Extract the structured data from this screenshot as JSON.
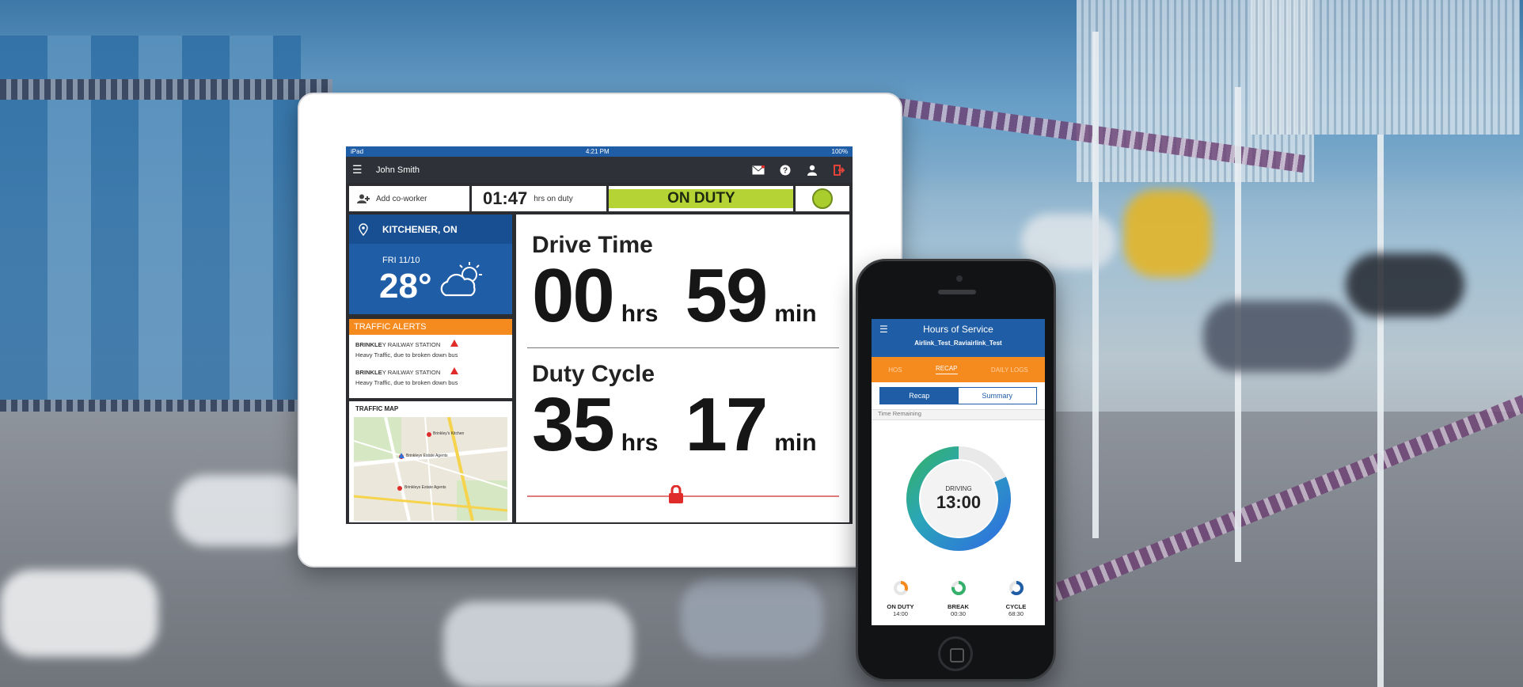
{
  "tablet": {
    "status": {
      "left": "iPad",
      "time": "4:21 PM",
      "battery": "100%"
    },
    "app_bar": {
      "user_name": "John Smith"
    },
    "duty_bar": {
      "add_coworker": "Add co-worker",
      "hours_value": "01:47",
      "hours_label": "hrs on duty",
      "status": "ON DUTY",
      "status_color": "#b5d334"
    },
    "weather": {
      "location": "KITCHENER, ON",
      "date": "FRI 11/10",
      "temperature": "28°",
      "icon": "partly-cloudy-icon"
    },
    "traffic_alerts": {
      "title": "TRAFFIC ALERTS",
      "items": [
        {
          "place_bold": "BRINKLE",
          "place_rest": "Y RAILWAY STATION",
          "detail": "Heavy Traffic, due to broken down bus"
        },
        {
          "place_bold": "BRINKLE",
          "place_rest": "Y RAILWAY STATION",
          "detail": "Heavy Traffic, due to broken down bus"
        }
      ]
    },
    "traffic_map": {
      "title": "TRAFFIC MAP",
      "labels": [
        "Brinkley's Kitchen",
        "Brinkleys Estate Agents",
        "Brinkleys Estate Agents"
      ]
    },
    "drive_time": {
      "title": "Drive Time",
      "hours": "00",
      "hours_unit": "hrs",
      "minutes": "59",
      "minutes_unit": "min"
    },
    "duty_cycle": {
      "title": "Duty Cycle",
      "hours": "35",
      "hours_unit": "hrs",
      "minutes": "17",
      "minutes_unit": "min"
    }
  },
  "phone": {
    "header": {
      "title": "Hours of Service",
      "subtitle": "Airlink_Test_Raviairlink_Test"
    },
    "tabs": [
      "HOS",
      "RECAP",
      "DAILY LOGS"
    ],
    "active_tab": "RECAP",
    "segment": {
      "left": "Recap",
      "right": "Summary"
    },
    "time_remaining_label": "Time Remaining",
    "ring": {
      "label": "DRIVING",
      "value": "13:00"
    },
    "minis": [
      {
        "label": "ON DUTY",
        "value": "14:00",
        "color": "#f58a1f"
      },
      {
        "label": "BREAK",
        "value": "00:30",
        "color": "#35b06b"
      },
      {
        "label": "CYCLE",
        "value": "68:30",
        "color": "#1f5da7"
      }
    ]
  },
  "colors": {
    "brand_blue": "#1f5da7",
    "accent_orange": "#f58a1f",
    "alert_red": "#e02b2b"
  }
}
